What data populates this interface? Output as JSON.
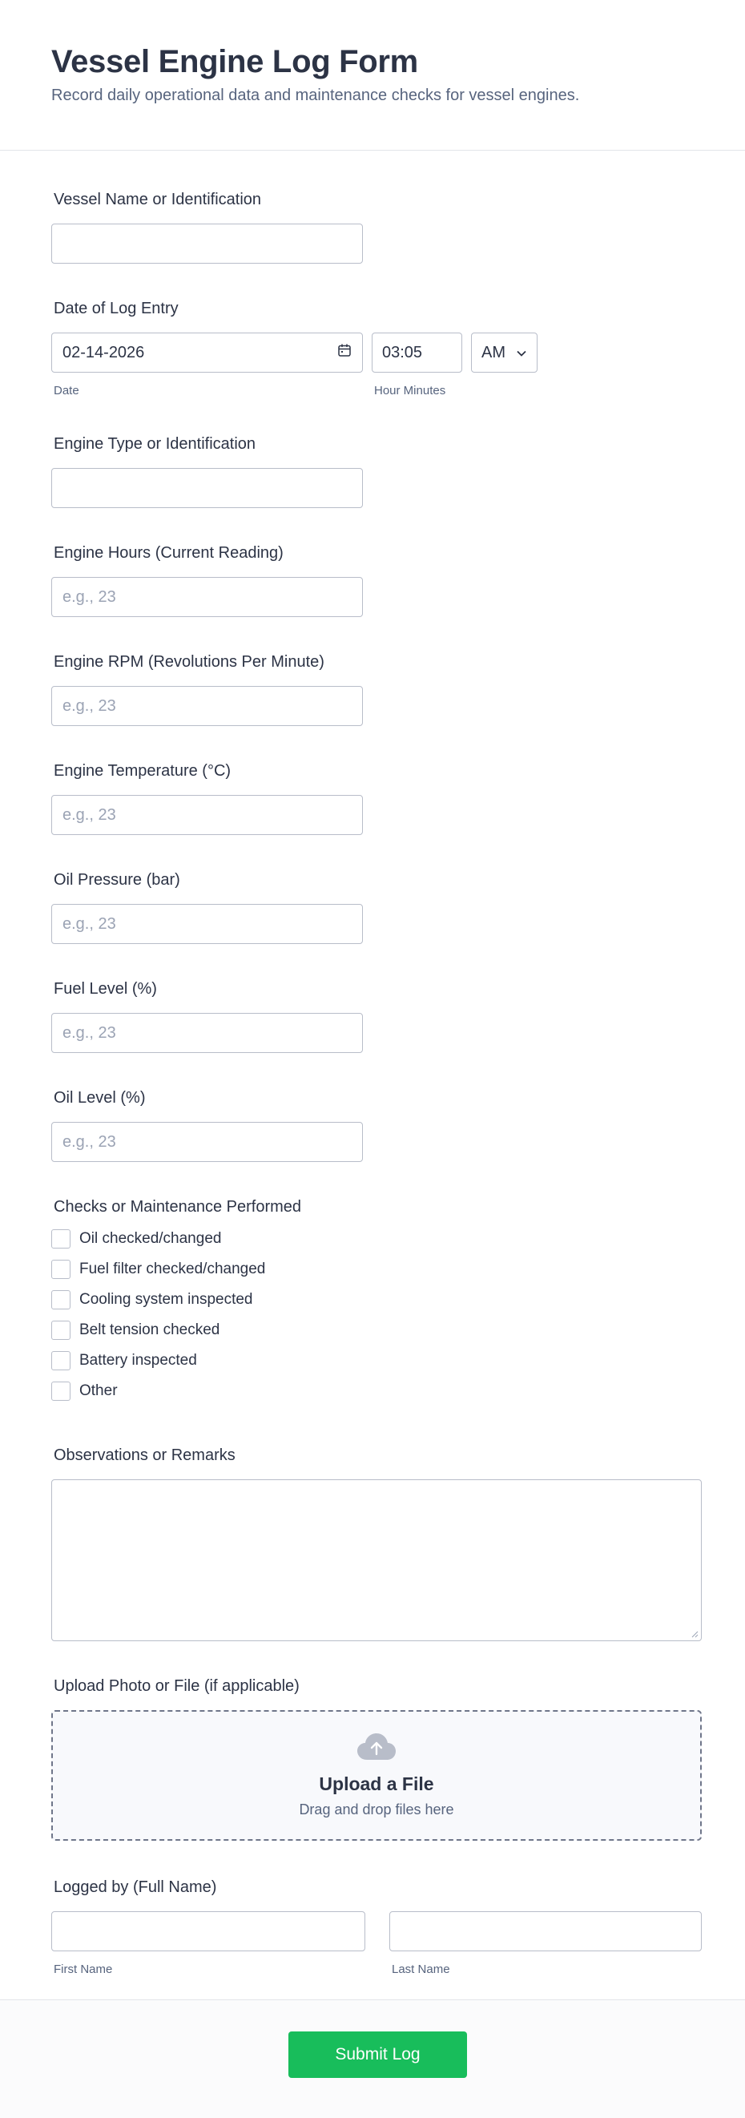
{
  "header": {
    "title": "Vessel Engine Log Form",
    "subtitle": "Record daily operational data and maintenance checks for vessel engines."
  },
  "fields": {
    "vessel_name": {
      "label": "Vessel Name or Identification",
      "value": ""
    },
    "log_date": {
      "label": "Date of Log Entry",
      "date_value": "02-14-2026",
      "time_value": "03:05",
      "ampm_value": "AM",
      "date_sublabel": "Date",
      "time_sublabel": "Hour Minutes"
    },
    "engine_type": {
      "label": "Engine Type or Identification",
      "value": ""
    },
    "engine_hours": {
      "label": "Engine Hours (Current Reading)",
      "placeholder": "e.g., 23"
    },
    "engine_rpm": {
      "label": "Engine RPM (Revolutions Per Minute)",
      "placeholder": "e.g., 23"
    },
    "engine_temp": {
      "label": "Engine Temperature (°C)",
      "placeholder": "e.g., 23"
    },
    "oil_pressure": {
      "label": "Oil Pressure (bar)",
      "placeholder": "e.g., 23"
    },
    "fuel_level": {
      "label": "Fuel Level (%)",
      "placeholder": "e.g., 23"
    },
    "oil_level": {
      "label": "Oil Level (%)",
      "placeholder": "e.g., 23"
    },
    "checks": {
      "label": "Checks or Maintenance Performed",
      "options": [
        "Oil checked/changed",
        "Fuel filter checked/changed",
        "Cooling system inspected",
        "Belt tension checked",
        "Battery inspected",
        "Other"
      ]
    },
    "observations": {
      "label": "Observations or Remarks"
    },
    "upload": {
      "label": "Upload Photo or File (if applicable)",
      "title": "Upload a File",
      "subtitle": "Drag and drop files here"
    },
    "logged_by": {
      "label": "Logged by (Full Name)",
      "first_sublabel": "First Name",
      "last_sublabel": "Last Name"
    }
  },
  "submit_label": "Submit Log",
  "icons": {
    "calendar": "calendar-icon",
    "chevron": "chevron-down-icon",
    "upload": "cloud-upload-icon"
  }
}
